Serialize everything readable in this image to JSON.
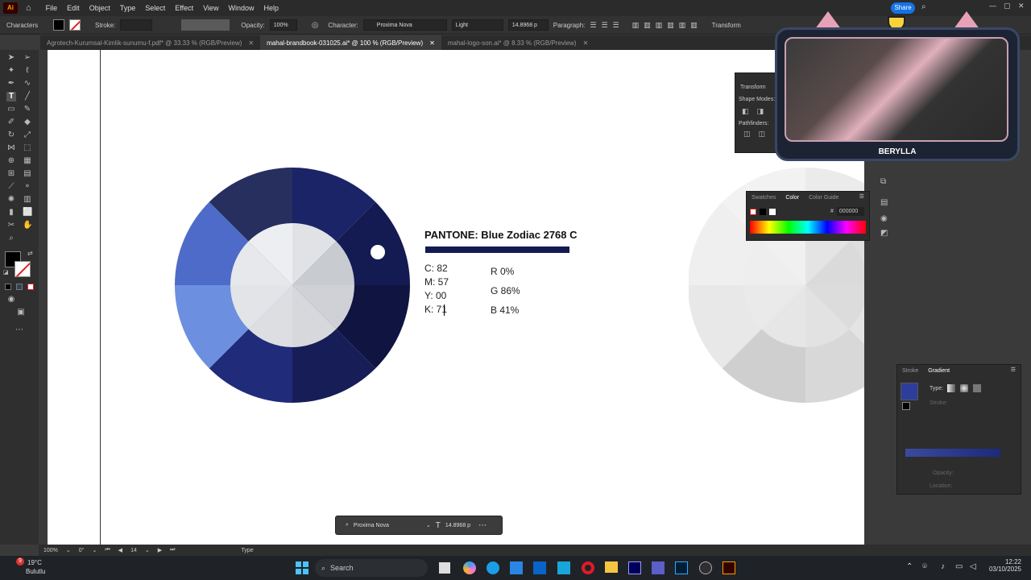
{
  "menubar": {
    "logo": "Ai",
    "items": [
      "File",
      "Edit",
      "Object",
      "Type",
      "Select",
      "Effect",
      "View",
      "Window",
      "Help"
    ],
    "share_label": "Share"
  },
  "ctrlbar": {
    "panel_label": "Characters",
    "stroke_label": "Stroke:",
    "opacity_label": "Opacity:",
    "opacity_value": "100%",
    "character_label": "Character:",
    "font_value": "Proxima Nova",
    "weight_value": "Light",
    "size_value": "14.8968 p",
    "paragraph_label": "Paragraph:",
    "transform_label": "Transform"
  },
  "tabs": [
    {
      "label": "Agrotech-Kurumsal-Kimlik-sunumu-f.pdf* @ 33.33 % (RGB/Preview)",
      "active": false
    },
    {
      "label": "mahal-brandbook-031025.ai* @ 100 % (RGB/Preview)",
      "active": true
    },
    {
      "label": "mahal-logo-son.ai* @ 8.33 % (RGB/Preview)",
      "active": false
    }
  ],
  "artboard": {
    "pantone_title": "PANTONE: Blue Zodiac 2768 C",
    "cmyk": [
      "C: 82",
      "M: 57",
      "Y: 00",
      "K: 71"
    ],
    "rgb": [
      "R 0%",
      "G 86%",
      "B 41%"
    ],
    "colors": {
      "wheel_segments": [
        "#262f5e",
        "#1b2466",
        "#141b52",
        "#0f1440",
        "#161d57",
        "#202b7a",
        "#6d8fe0",
        "#4e6bc9",
        "#2c3d9b"
      ],
      "inner_circle": "#e2e4e8",
      "swatch_bar": "#141b52"
    }
  },
  "transform_panel": {
    "title": "Transform",
    "shape_modes": "Shape Modes:",
    "pathfinders": "Pathfinders:"
  },
  "color_panel": {
    "tabs": [
      "Swatches",
      "Color",
      "Color Guide"
    ],
    "hex_value": "000000",
    "hex_label": "#"
  },
  "gradient_panel": {
    "tabs": [
      "Stroke",
      "Gradient"
    ],
    "type_label": "Type:",
    "stroke_label": "Stroke:",
    "opacity_label": "Opacity:",
    "location_label": "Location:"
  },
  "webcam": {
    "name": "BERYLLA"
  },
  "floating_bar": {
    "font": "Proxima Nova",
    "size": "14.8968 p"
  },
  "statusbar": {
    "zoom": "100%",
    "rotation": "0°",
    "artboard_num": "14",
    "tool": "Type"
  },
  "taskbar": {
    "weather_temp": "19°C",
    "weather_desc": "Bulutlu",
    "notif_count": "9",
    "search_placeholder": "Search",
    "time": "12:22",
    "date": "03/10/2025"
  }
}
